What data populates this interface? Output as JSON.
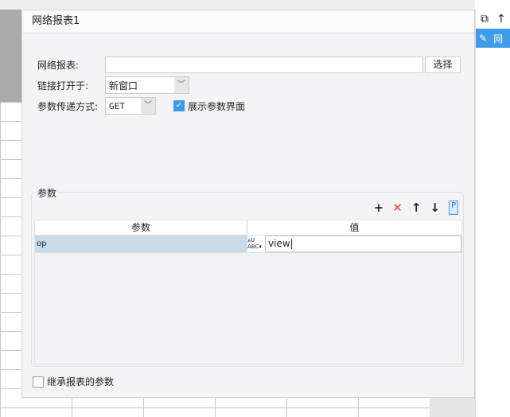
{
  "dialog": {
    "title": "网络报表1",
    "report_label": "网络报表:",
    "report_value": "",
    "select_button": "选择",
    "open_label": "链接打开于:",
    "open_value": "新窗口",
    "method_label": "参数传递方式:",
    "method_value": "GET",
    "show_params_label": "展示参数界面",
    "show_params_checked": true,
    "params_group": "参数",
    "columns": [
      "参数",
      "值"
    ],
    "rows": [
      {
        "name": "op",
        "value": "view"
      }
    ],
    "inherit_label": "继承报表的参数",
    "inherit_checked": false
  },
  "right_panel": {
    "item_label": "网"
  },
  "colors": {
    "accent": "#3d9be9",
    "selected_row": "#c8dbe8",
    "delete": "#e84040"
  }
}
